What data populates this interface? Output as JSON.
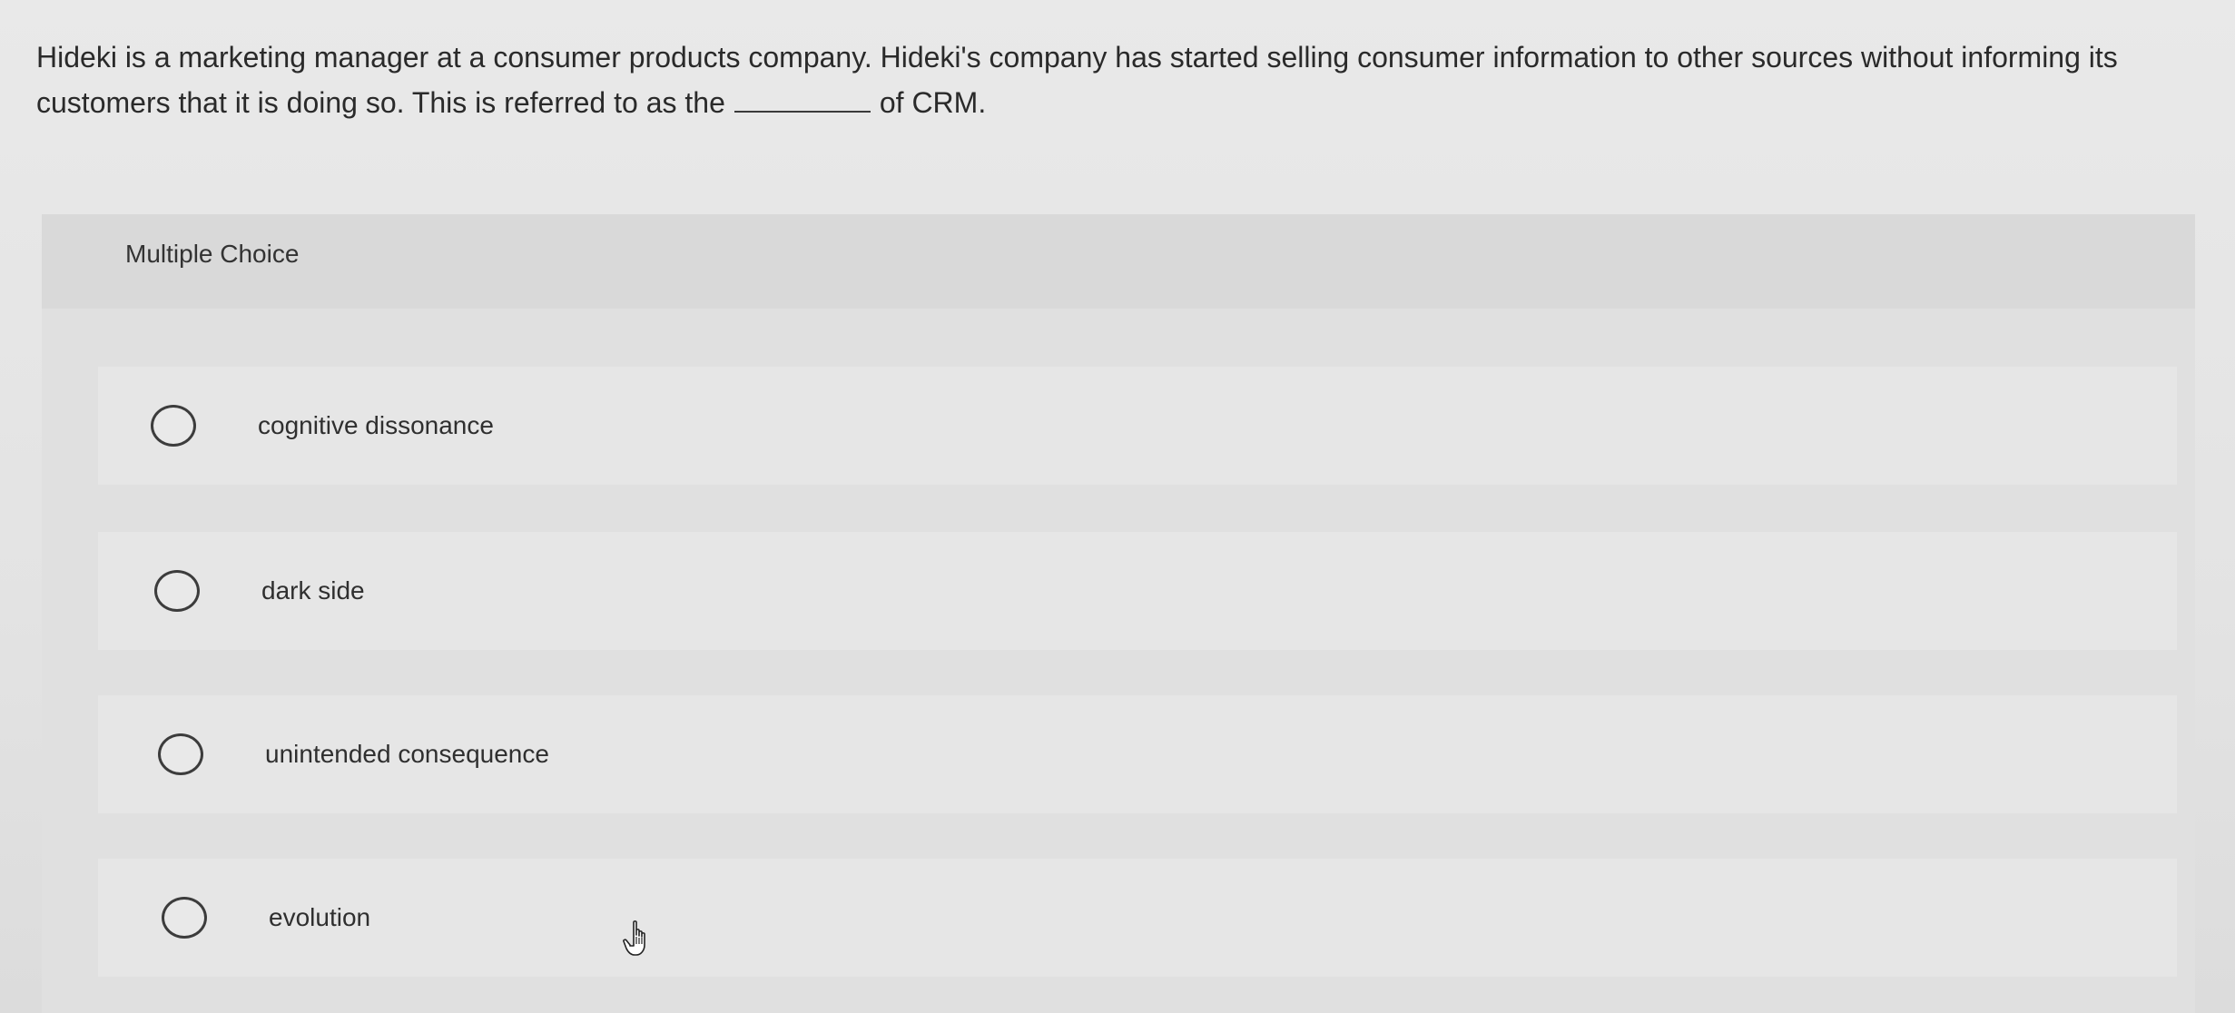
{
  "question": {
    "part1": "Hideki is a marketing manager at a consumer products company. Hideki's company has started selling consumer information to other sources without informing its customers that it is doing so. This is referred to as the",
    "part2": "of CRM."
  },
  "panel": {
    "title": "Multiple Choice"
  },
  "options": [
    {
      "label": "cognitive dissonance"
    },
    {
      "label": "dark side"
    },
    {
      "label": "unintended consequence"
    },
    {
      "label": "evolution"
    }
  ],
  "cursor": {
    "icon": "hand-pointer-icon"
  }
}
